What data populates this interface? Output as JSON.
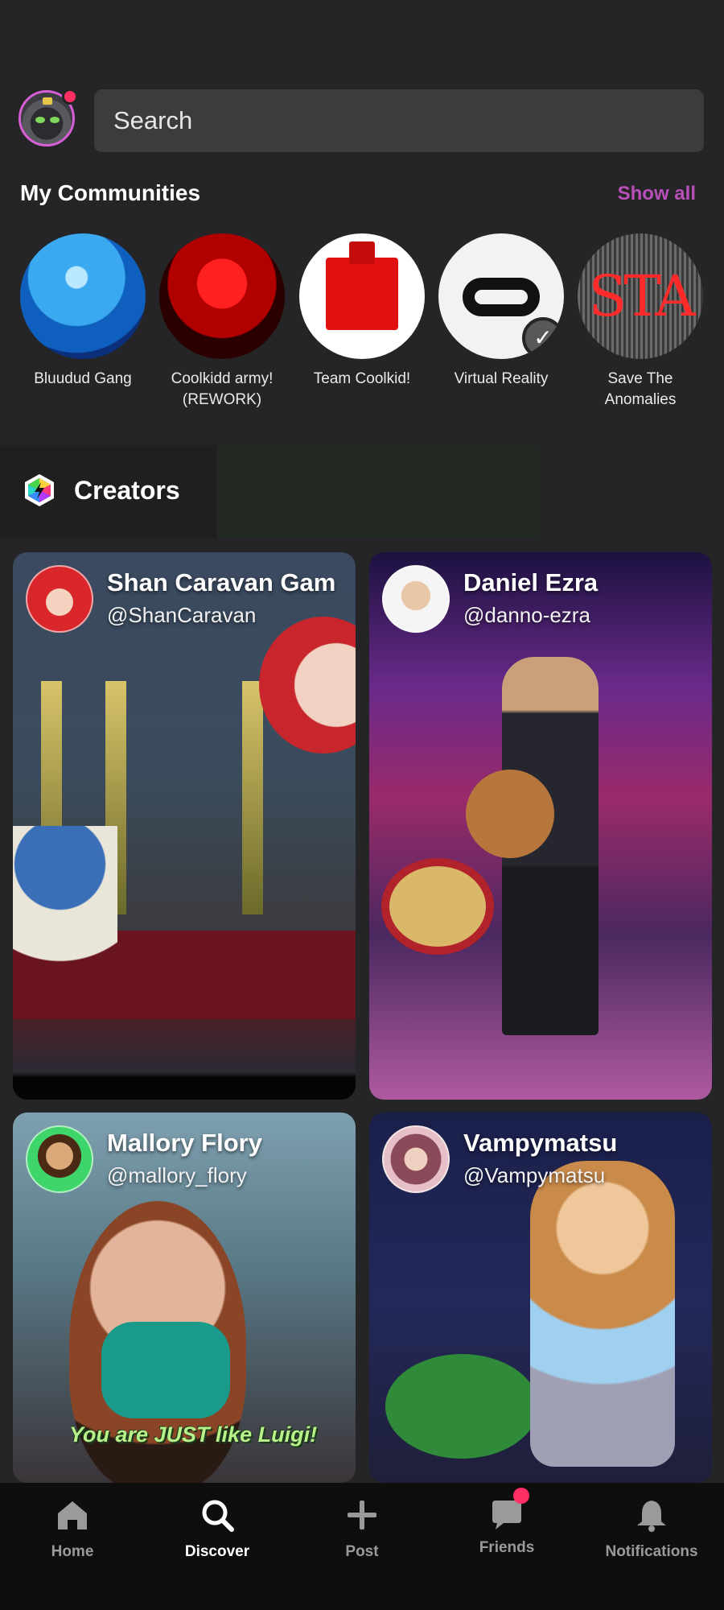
{
  "search": {
    "placeholder": "Search"
  },
  "communities": {
    "title": "My Communities",
    "show_all": "Show all",
    "items": [
      {
        "name": "Bluudud Gang",
        "image_text": ""
      },
      {
        "name": "Coolkidd army! (REWORK)",
        "image_text": ""
      },
      {
        "name": "Team Coolkid!",
        "image_text": ""
      },
      {
        "name": "Virtual Reality",
        "image_text": ""
      },
      {
        "name": "Save The Anomalies",
        "image_text": "STA"
      }
    ]
  },
  "creators": {
    "title": "Creators",
    "cards": [
      {
        "name": "Shan Caravan Gam",
        "handle": "@ShanCaravan"
      },
      {
        "name": "Daniel Ezra",
        "handle": "@danno-ezra"
      },
      {
        "name": "Mallory Flory",
        "handle": "@mallory_flory",
        "caption": "You are JUST like Luigi!"
      },
      {
        "name": "Vampymatsu",
        "handle": "@Vampymatsu"
      }
    ]
  },
  "nav": {
    "items": [
      {
        "label": "Home",
        "icon": "home-icon"
      },
      {
        "label": "Discover",
        "icon": "search-icon",
        "active": true
      },
      {
        "label": "Post",
        "icon": "plus-icon"
      },
      {
        "label": "Friends",
        "icon": "chat-icon",
        "badge": true
      },
      {
        "label": "Notifications",
        "icon": "bell-icon"
      }
    ]
  },
  "colors": {
    "background": "#252527",
    "accent": "#b94fb9",
    "badge": "#ff2e63",
    "search_bg": "#3c3c3e",
    "nav_bg": "#0e0e0f"
  }
}
